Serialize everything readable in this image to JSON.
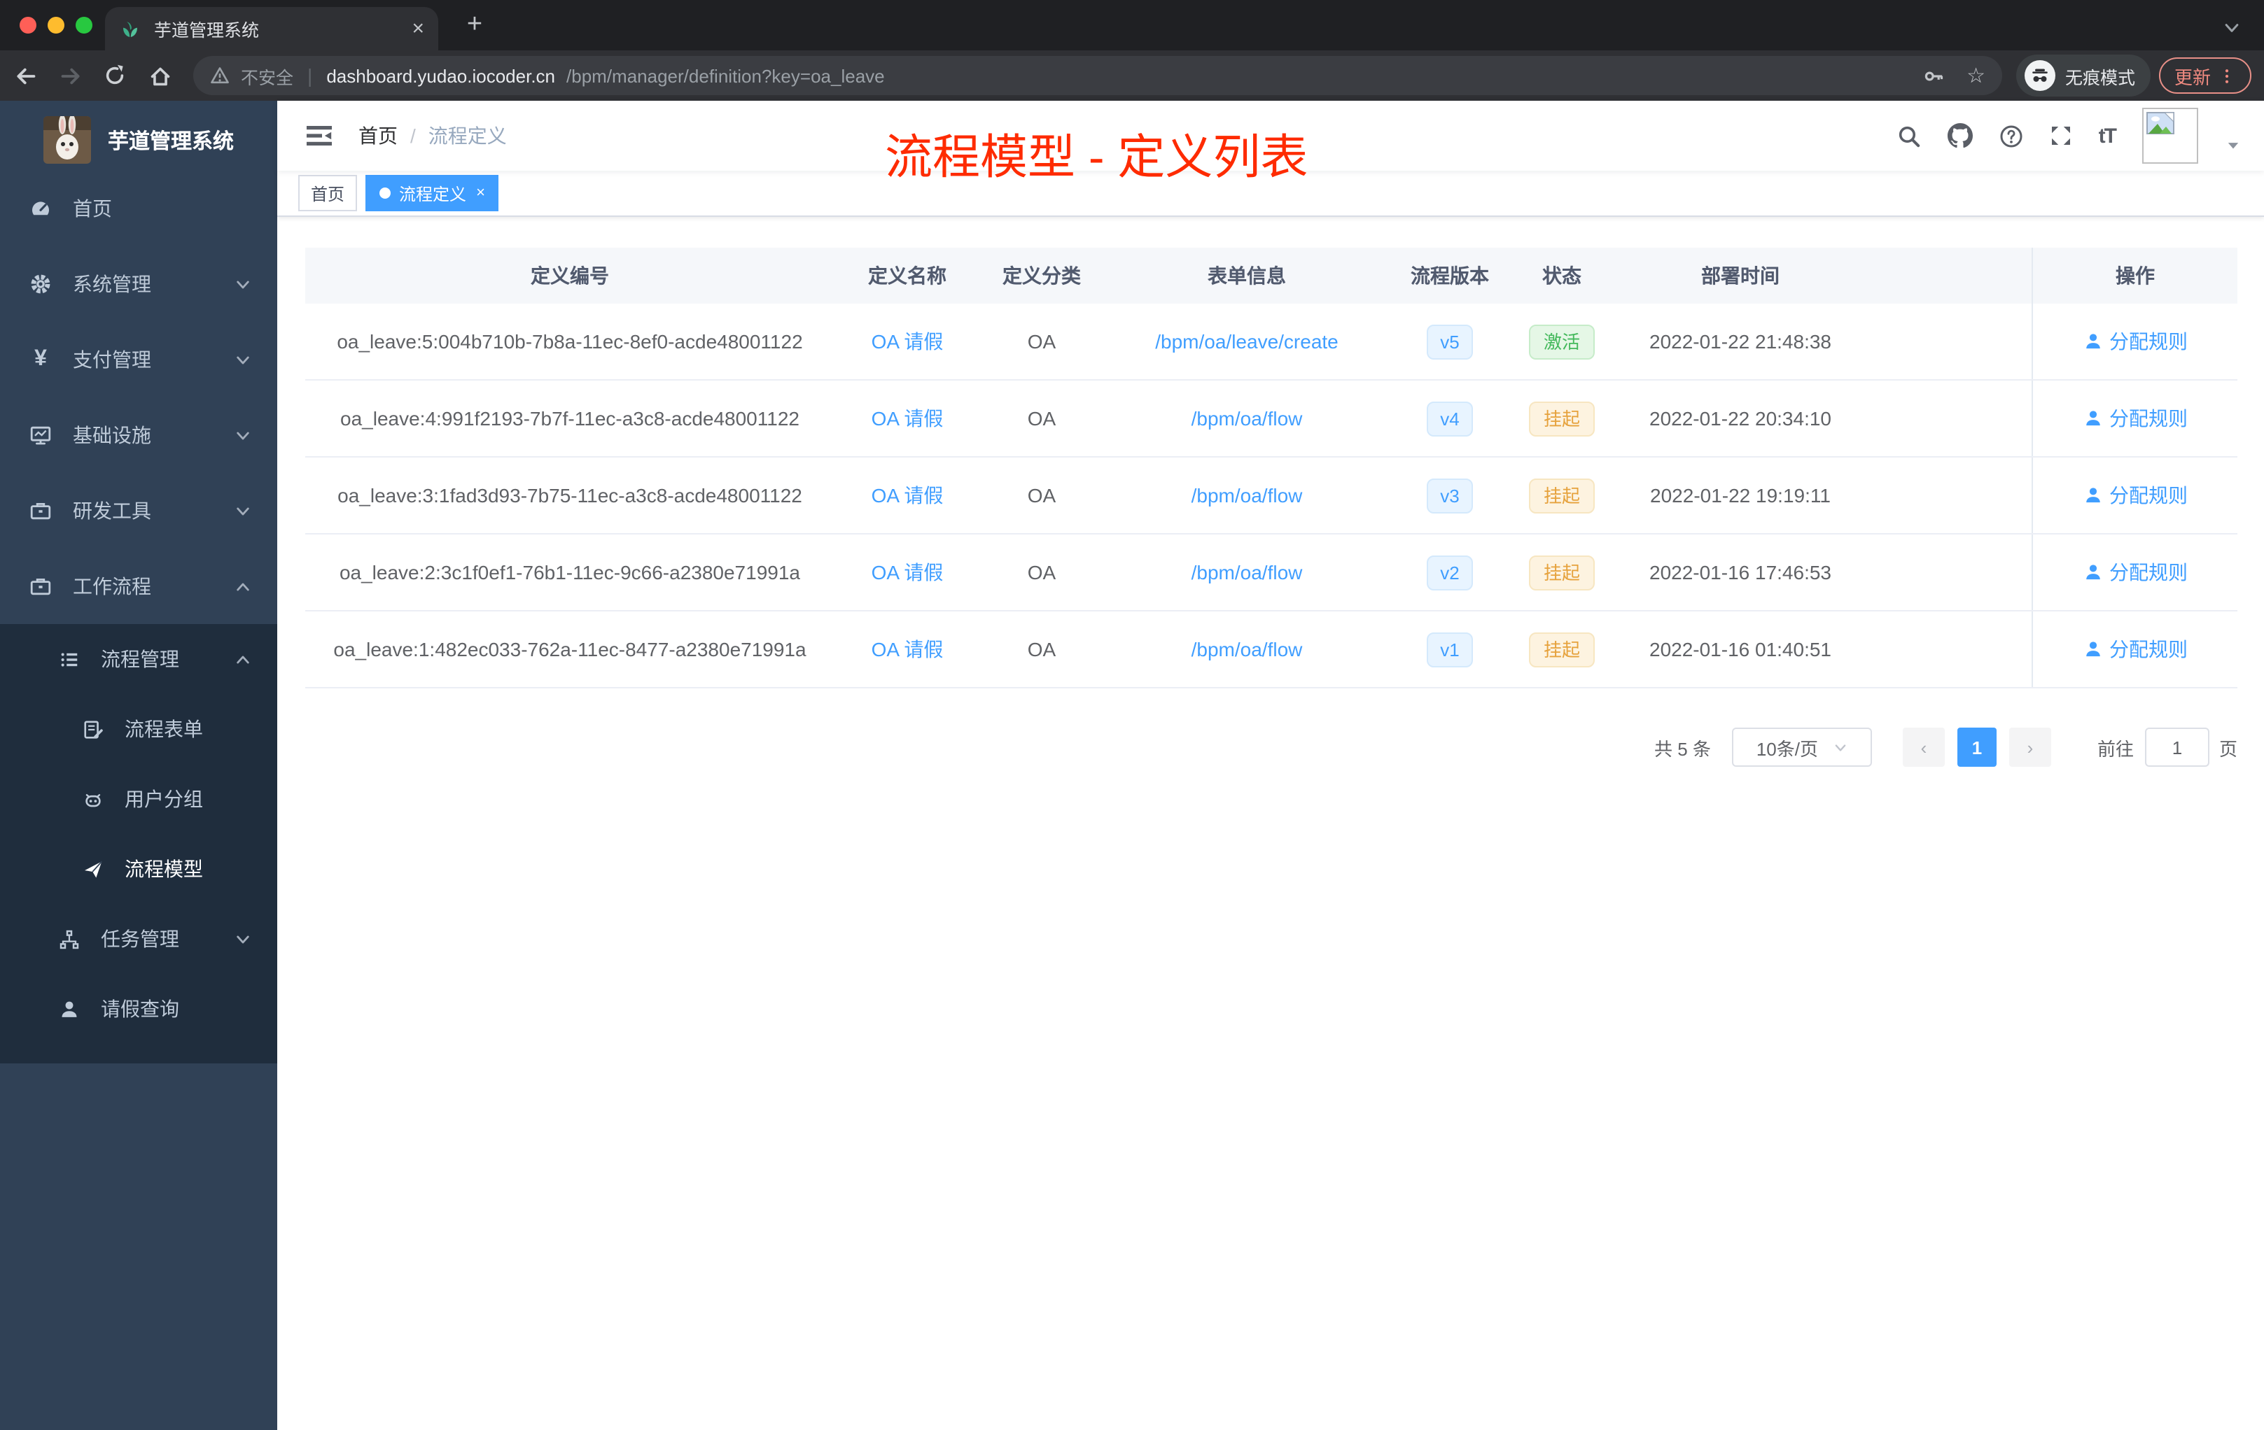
{
  "browser": {
    "tab_title": "芋道管理系统",
    "security": "不安全",
    "url_host": "dashboard.yudao.iocoder.cn",
    "url_path": "/bpm/manager/definition?key=oa_leave",
    "incognito": "无痕模式",
    "update": "更新"
  },
  "icons": {
    "new_tab": "+",
    "close": "×",
    "url_sep": "|",
    "star": "☆",
    "yen": "¥",
    "fontsize": "tT",
    "breadcrumb_sep": "/",
    "prev": "‹",
    "next": "›"
  },
  "sidebar": {
    "title": "芋道管理系统",
    "menu": [
      {
        "label": "首页"
      },
      {
        "label": "系统管理"
      },
      {
        "label": "支付管理"
      },
      {
        "label": "基础设施"
      },
      {
        "label": "研发工具"
      },
      {
        "label": "工作流程"
      }
    ],
    "submenu": {
      "process_mgmt": {
        "label": "流程管理"
      },
      "children": [
        {
          "label": "流程表单"
        },
        {
          "label": "用户分组"
        },
        {
          "label": "流程模型"
        }
      ],
      "task_mgmt": {
        "label": "任务管理"
      },
      "leave_query": {
        "label": "请假查询"
      }
    }
  },
  "header": {
    "breadcrumb": {
      "home": "首页",
      "current": "流程定义"
    },
    "annotation": "流程模型 - 定义列表"
  },
  "tags": [
    {
      "label": "首页",
      "active": false
    },
    {
      "label": "流程定义",
      "active": true
    }
  ],
  "table": {
    "headers": [
      "定义编号",
      "定义名称",
      "定义分类",
      "表单信息",
      "流程版本",
      "状态",
      "部署时间",
      "操作"
    ],
    "rows": [
      {
        "id": "oa_leave:5:004b710b-7b8a-11ec-8ef0-acde48001122",
        "name": "OA 请假",
        "category": "OA",
        "form": "/bpm/oa/leave/create",
        "version": "v5",
        "status": "激活",
        "status_kind": "success",
        "time": "2022-01-22 21:48:38",
        "action": "分配规则"
      },
      {
        "id": "oa_leave:4:991f2193-7b7f-11ec-a3c8-acde48001122",
        "name": "OA 请假",
        "category": "OA",
        "form": "/bpm/oa/flow",
        "version": "v4",
        "status": "挂起",
        "status_kind": "warning",
        "time": "2022-01-22 20:34:10",
        "action": "分配规则"
      },
      {
        "id": "oa_leave:3:1fad3d93-7b75-11ec-a3c8-acde48001122",
        "name": "OA 请假",
        "category": "OA",
        "form": "/bpm/oa/flow",
        "version": "v3",
        "status": "挂起",
        "status_kind": "warning",
        "time": "2022-01-22 19:19:11",
        "action": "分配规则"
      },
      {
        "id": "oa_leave:2:3c1f0ef1-76b1-11ec-9c66-a2380e71991a",
        "name": "OA 请假",
        "category": "OA",
        "form": "/bpm/oa/flow",
        "version": "v2",
        "status": "挂起",
        "status_kind": "warning",
        "time": "2022-01-16 17:46:53",
        "action": "分配规则"
      },
      {
        "id": "oa_leave:1:482ec033-762a-11ec-8477-a2380e71991a",
        "name": "OA 请假",
        "category": "OA",
        "form": "/bpm/oa/flow",
        "version": "v1",
        "status": "挂起",
        "status_kind": "warning",
        "time": "2022-01-16 01:40:51",
        "action": "分配规则"
      }
    ]
  },
  "pagination": {
    "total": "共 5 条",
    "size": "10条/页",
    "page": "1",
    "goto": "前往",
    "goto_value": "1",
    "unit": "页"
  },
  "colors": {
    "accent": "#409eff",
    "success": "#44b95c",
    "warning": "#e6a23c",
    "annotation": "#fe2b00",
    "sidebar_bg": "#304156",
    "submenu_bg": "#1f2d3d"
  }
}
